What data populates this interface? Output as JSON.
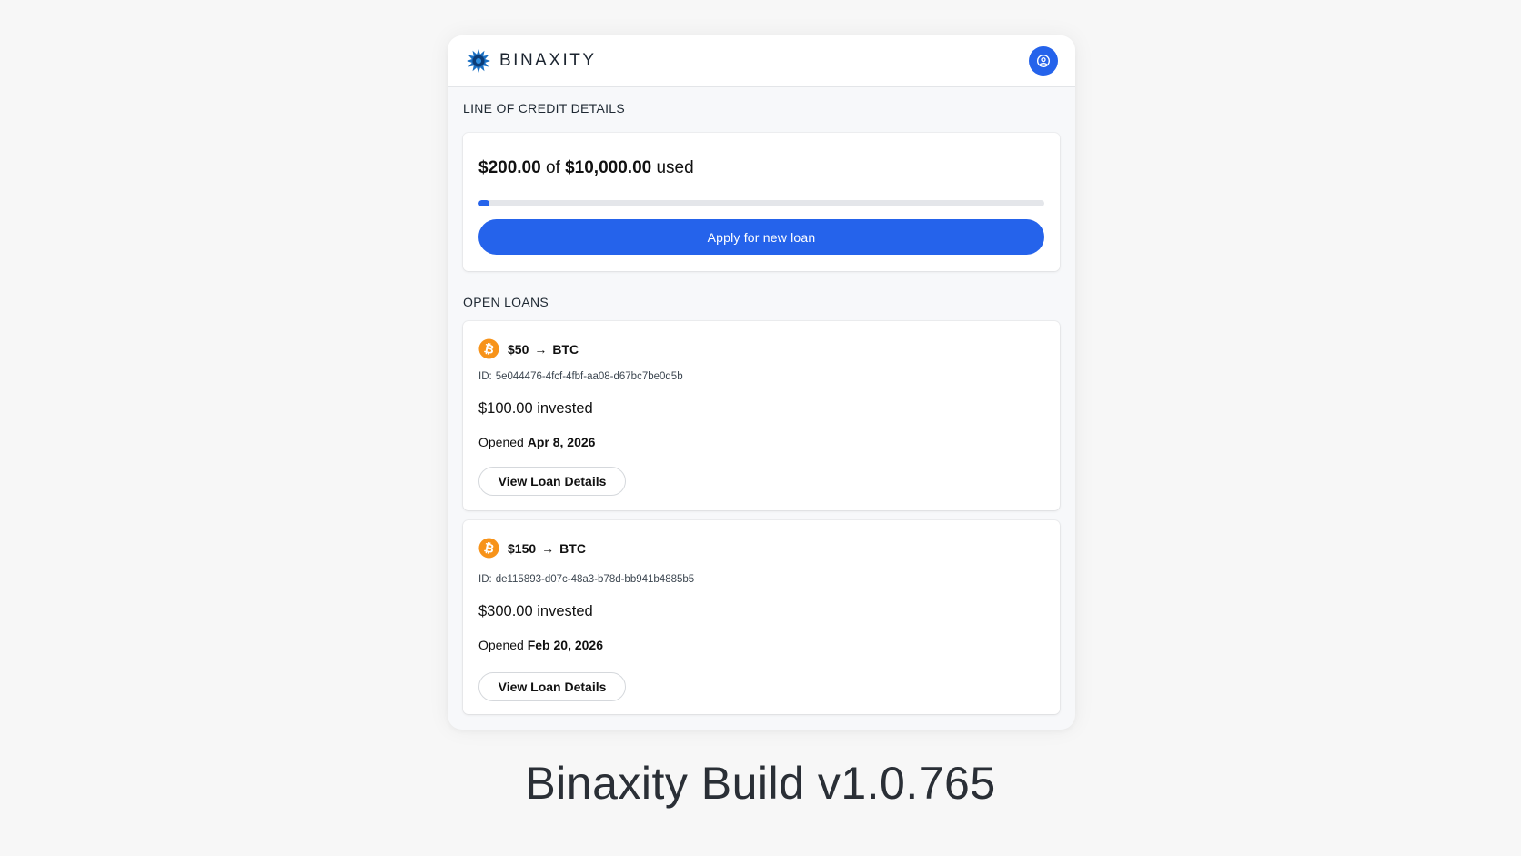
{
  "header": {
    "brand_name": "BINAXITY",
    "brand_icon": "binaxity-logo-icon",
    "profile_icon": "user-circle-icon"
  },
  "credit": {
    "section_title": "LINE OF CREDIT DETAILS",
    "used_amount": "$200.00",
    "of_label": "of",
    "limit_amount": "$10,000.00",
    "used_label": "used",
    "used_fraction": 0.02,
    "apply_button_label": "Apply for new loan"
  },
  "loans": {
    "section_title": "OPEN LOANS",
    "items": [
      {
        "icon": "bitcoin-icon",
        "amount": "$50",
        "arrow": "→",
        "asset": "BTC",
        "id_prefix": "ID:",
        "id": "5e044476-4fcf-4fbf-aa08-d67bc7be0d5b",
        "invested": "$100.00 invested",
        "opened_label": "Opened",
        "opened_date": "Apr 8, 2026",
        "view_button_label": "View Loan Details"
      },
      {
        "icon": "bitcoin-icon",
        "amount": "$150",
        "arrow": "→",
        "asset": "BTC",
        "id_prefix": "ID:",
        "id": "de115893-d07c-48a3-b78d-bb941b4885b5",
        "invested": "$300.00 invested",
        "opened_label": "Opened",
        "opened_date": "Feb 20, 2026",
        "view_button_label": "View Loan Details"
      }
    ]
  },
  "caption": "Binaxity Build v1.0.765",
  "colors": {
    "accent": "#2563eb",
    "bitcoin": "#f7931a",
    "brand_logo": "#1b5fa8"
  }
}
